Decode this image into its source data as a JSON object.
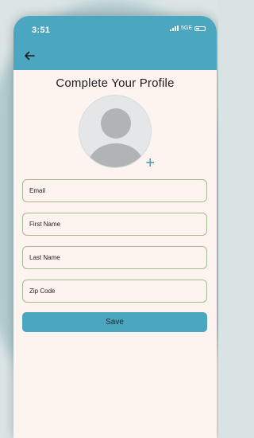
{
  "status_bar": {
    "time": "3:51",
    "network": "5GE"
  },
  "header": {
    "back_icon": "arrow-left-icon"
  },
  "page": {
    "title": "Complete Your Profile"
  },
  "avatar": {
    "icon": "person-icon",
    "add_icon": "plus-icon",
    "add_symbol": "+"
  },
  "form": {
    "email_placeholder": "Email",
    "first_name_placeholder": "First Name",
    "last_name_placeholder": "Last Name",
    "zip_placeholder": "Zip Code",
    "save_label": "Save"
  },
  "colors": {
    "accent": "#4ba6bf",
    "background": "#fdf4ef",
    "field_border": "#a6b796",
    "plus": "#3a9ab8"
  }
}
